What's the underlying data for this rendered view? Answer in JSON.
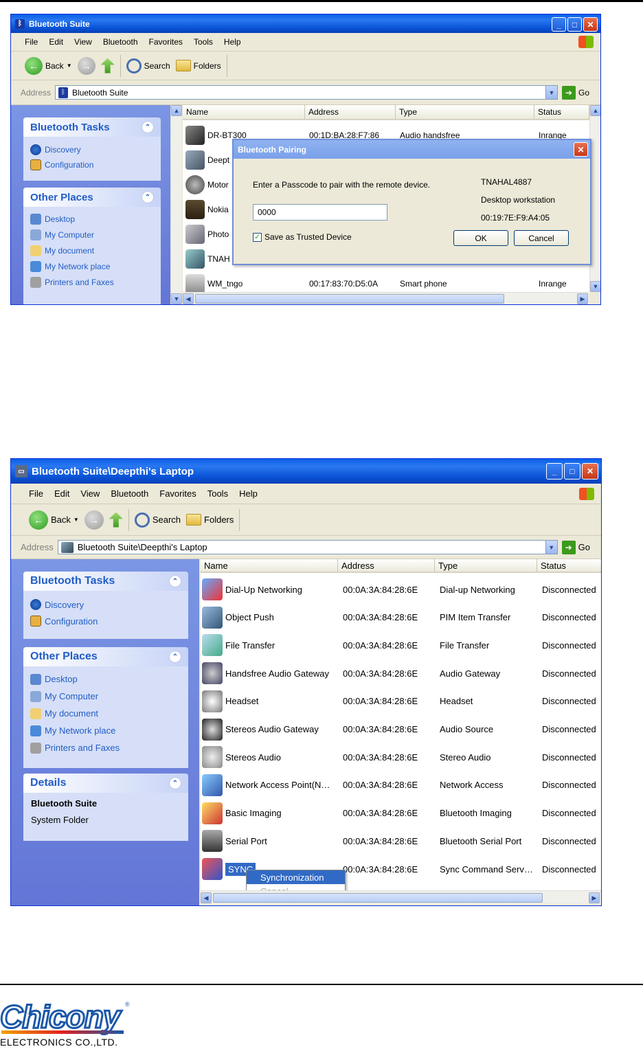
{
  "window1": {
    "title": "Bluetooth Suite",
    "menu": [
      "File",
      "Edit",
      "View",
      "Bluetooth",
      "Favorites",
      "Tools",
      "Help"
    ],
    "toolbar": {
      "back": "Back",
      "search": "Search",
      "folders": "Folders"
    },
    "address_label": "Address",
    "address_value": "Bluetooth Suite",
    "go": "Go",
    "tasks_title": "Bluetooth Tasks",
    "tasks": [
      "Discovery",
      "Configuration"
    ],
    "places_title": "Other Places",
    "places": [
      "Desktop",
      "My Computer",
      "My document",
      "My Network place",
      "Printers and Faxes"
    ],
    "columns": [
      "Name",
      "Address",
      "Type",
      "Status"
    ],
    "rows": [
      {
        "name": "DR-BT300",
        "address": "00:1D:BA:28:F7:86",
        "type": "Audio handsfree",
        "status": "Inrange"
      },
      {
        "name": "Deept",
        "address": "",
        "type": "",
        "status": ""
      },
      {
        "name": "Motor",
        "address": "",
        "type": "",
        "status": ""
      },
      {
        "name": "Nokia",
        "address": "",
        "type": "",
        "status": ""
      },
      {
        "name": "Photo",
        "address": "",
        "type": "",
        "status": ""
      },
      {
        "name": "TNAH",
        "address": "",
        "type": "",
        "status": ""
      },
      {
        "name": "WM_tngo",
        "address": "00:17:83:70:D5:0A",
        "type": "Smart phone",
        "status": "Inrange"
      }
    ],
    "dialog": {
      "title": "Bluetooth Pairing",
      "prompt": "Enter a Passcode to pair with the remote device.",
      "passcode": "0000",
      "checkbox": "Save as Trusted Device",
      "device_name": "TNAHAL4887",
      "device_type": "Desktop workstation",
      "device_address": "00:19:7E:F9:A4:05",
      "ok": "OK",
      "cancel": "Cancel"
    }
  },
  "window2": {
    "title": "Bluetooth Suite\\Deepthi's Laptop",
    "menu": [
      "File",
      "Edit",
      "View",
      "Bluetooth",
      "Favorites",
      "Tools",
      "Help"
    ],
    "toolbar": {
      "back": "Back",
      "search": "Search",
      "folders": "Folders"
    },
    "address_label": "Address",
    "address_value": "Bluetooth Suite\\Deepthi's Laptop",
    "go": "Go",
    "tasks_title": "Bluetooth Tasks",
    "tasks": [
      "Discovery",
      "Configuration"
    ],
    "places_title": "Other Places",
    "places": [
      "Desktop",
      "My Computer",
      "My document",
      "My Network place",
      "Printers and Faxes"
    ],
    "details_title": "Details",
    "details_name": "Bluetooth Suite",
    "details_type": "System Folder",
    "columns": [
      "Name",
      "Address",
      "Type",
      "Status"
    ],
    "rows": [
      {
        "name": "Dial-Up Networking",
        "address": "00:0A:3A:84:28:6E",
        "type": "Dial-up Networking",
        "status": "Disconnected"
      },
      {
        "name": "Object Push",
        "address": "00:0A:3A:84:28:6E",
        "type": "PIM Item Transfer",
        "status": "Disconnected"
      },
      {
        "name": "File Transfer",
        "address": "00:0A:3A:84:28:6E",
        "type": "File Transfer",
        "status": "Disconnected"
      },
      {
        "name": "Handsfree Audio Gateway",
        "address": "00:0A:3A:84:28:6E",
        "type": "Audio Gateway",
        "status": "Disconnected"
      },
      {
        "name": "Headset",
        "address": "00:0A:3A:84:28:6E",
        "type": "Headset",
        "status": "Disconnected"
      },
      {
        "name": "Stereos Audio Gateway",
        "address": "00:0A:3A:84:28:6E",
        "type": "Audio Source",
        "status": "Disconnected"
      },
      {
        "name": "Stereos Audio",
        "address": "00:0A:3A:84:28:6E",
        "type": "Stereo Audio",
        "status": "Disconnected"
      },
      {
        "name": "Network Access Point(N…",
        "address": "00:0A:3A:84:28:6E",
        "type": "Network Access",
        "status": "Disconnected"
      },
      {
        "name": "Basic Imaging",
        "address": "00:0A:3A:84:28:6E",
        "type": "Bluetooth Imaging",
        "status": "Disconnected"
      },
      {
        "name": "Serial Port",
        "address": "00:0A:3A:84:28:6E",
        "type": "Bluetooth Serial Port",
        "status": "Disconnected"
      },
      {
        "name": "SYNC",
        "address": "00:0A:3A:84:28:6E",
        "type": "Sync Command Serv…",
        "status": "Disconnected"
      }
    ],
    "context_menu": [
      "Synchronization",
      "Cancel"
    ]
  },
  "logo": {
    "brand": "Chicony",
    "sub": "ELECTRONICS CO.,LTD.",
    "reg": "®"
  }
}
